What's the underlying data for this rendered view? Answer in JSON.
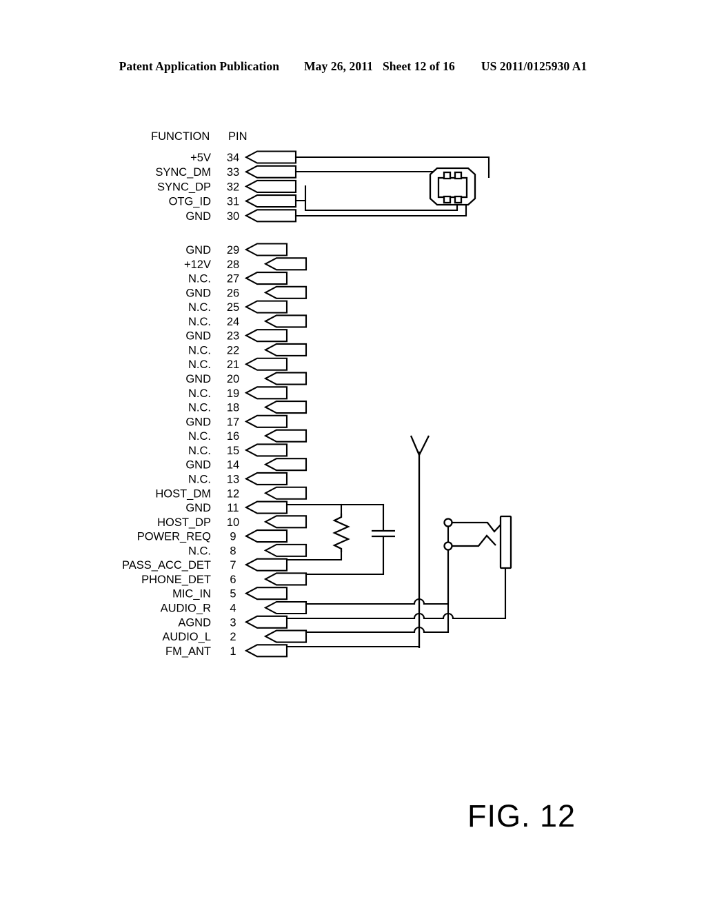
{
  "header": {
    "publication": "Patent Application Publication",
    "date": "May 26, 2011",
    "sheet": "Sheet 12 of 16",
    "number": "US 2011/0125930 A1"
  },
  "figure": {
    "caption": "FIG. 12",
    "columns": {
      "function": "FUNCTION",
      "pin": "PIN"
    },
    "top_group": [
      {
        "function": "+5V",
        "pin": "34"
      },
      {
        "function": "SYNC_DM",
        "pin": "33"
      },
      {
        "function": "SYNC_DP",
        "pin": "32"
      },
      {
        "function": "OTG_ID",
        "pin": "31"
      },
      {
        "function": "GND",
        "pin": "30"
      }
    ],
    "main_group": [
      {
        "function": "GND",
        "pin": "29"
      },
      {
        "function": "+12V",
        "pin": "28"
      },
      {
        "function": "N.C.",
        "pin": "27"
      },
      {
        "function": "GND",
        "pin": "26"
      },
      {
        "function": "N.C.",
        "pin": "25"
      },
      {
        "function": "N.C.",
        "pin": "24"
      },
      {
        "function": "GND",
        "pin": "23"
      },
      {
        "function": "N.C.",
        "pin": "22"
      },
      {
        "function": "N.C.",
        "pin": "21"
      },
      {
        "function": "GND",
        "pin": "20"
      },
      {
        "function": "N.C.",
        "pin": "19"
      },
      {
        "function": "N.C.",
        "pin": "18"
      },
      {
        "function": "GND",
        "pin": "17"
      },
      {
        "function": "N.C.",
        "pin": "16"
      },
      {
        "function": "N.C.",
        "pin": "15"
      },
      {
        "function": "GND",
        "pin": "14"
      },
      {
        "function": "N.C.",
        "pin": "13"
      },
      {
        "function": "HOST_DM",
        "pin": "12"
      },
      {
        "function": "GND",
        "pin": "11"
      },
      {
        "function": "HOST_DP",
        "pin": "10"
      },
      {
        "function": "POWER_REQ",
        "pin": "9"
      },
      {
        "function": "N.C.",
        "pin": "8"
      },
      {
        "function": "PASS_ACC_DET",
        "pin": "7"
      },
      {
        "function": "PHONE_DET",
        "pin": "6"
      },
      {
        "function": "MIC_IN",
        "pin": "5"
      },
      {
        "function": "AUDIO_R",
        "pin": "4"
      },
      {
        "function": "AGND",
        "pin": "3"
      },
      {
        "function": "AUDIO_L",
        "pin": "2"
      },
      {
        "function": "FM_ANT",
        "pin": "1"
      }
    ],
    "components": [
      {
        "name": "usb-connector",
        "type": "connector"
      },
      {
        "name": "resistor",
        "type": "resistor"
      },
      {
        "name": "capacitor",
        "type": "capacitor"
      },
      {
        "name": "fm-antenna",
        "type": "antenna"
      },
      {
        "name": "switch-upper",
        "type": "switch"
      },
      {
        "name": "switch-lower",
        "type": "switch"
      },
      {
        "name": "load-element",
        "type": "load"
      }
    ]
  },
  "colors": {
    "ink": "#000000",
    "paper": "#ffffff"
  }
}
